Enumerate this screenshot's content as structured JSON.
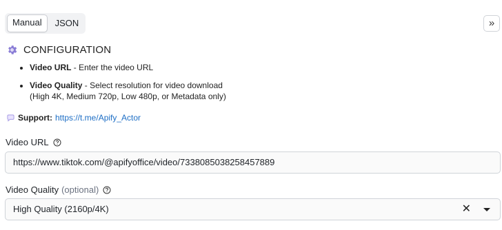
{
  "tabs": [
    {
      "label": "Manual",
      "active": true
    },
    {
      "label": "JSON",
      "active": false
    }
  ],
  "expand_label": "»",
  "config": {
    "heading": "CONFIGURATION",
    "items": [
      {
        "title": "Video URL",
        "text": " - Enter the video URL"
      },
      {
        "title": "Video Quality",
        "text": " - Select resolution for video download",
        "note": "(High 4K, Medium 720p, Low 480p, or Metadata only)"
      }
    ],
    "support_label": "Support:",
    "support_link": "https://t.me/Apify_Actor"
  },
  "fields": {
    "video_url": {
      "label": "Video URL",
      "value": "https://www.tiktok.com/@apifyoffice/video/7338085038258457889"
    },
    "video_quality": {
      "label": "Video Quality",
      "optional": "(optional)",
      "value": "High Quality (2160p/4K)",
      "clear": "✕"
    }
  },
  "colors": {
    "link": "#1d6ec5",
    "accent_icon": "#8a7dd6"
  },
  "icons": [
    "gear-icon",
    "speech-bubble-icon",
    "help-circle-icon",
    "clear-icon",
    "caret-down-icon"
  ]
}
